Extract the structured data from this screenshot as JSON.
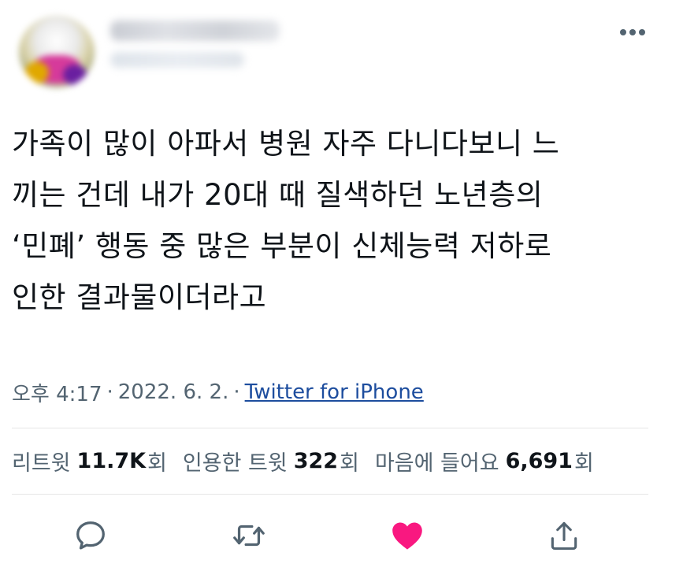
{
  "tweet": {
    "text": "가족이 많이 아파서 병원 자주 다니다보니 느\n끼는 건데 내가 20대 때 질색하던 노년층의\n‘민폐’ 행동 중 많은 부분이 신체능력 저하로\n인한 결과물이더라고",
    "time": "오후 4:17",
    "separator": "·",
    "date": "2022. 6. 2.",
    "source": "Twitter for iPhone"
  },
  "stats": {
    "retweets": {
      "label": "리트윗",
      "value": "11.7K",
      "unit": "회"
    },
    "quotes": {
      "label": "인용한 트윗",
      "value": "322",
      "unit": "회"
    },
    "likes": {
      "label": "마음에 들어요",
      "value": "6,691",
      "unit": "회"
    }
  },
  "icons": {
    "more": "more-horizontal-icon",
    "reply": "reply-bubble-icon",
    "retweet": "retweet-icon",
    "like": "heart-filled-icon",
    "share": "share-icon"
  },
  "colors": {
    "text": "#0f1419",
    "secondary": "#536471",
    "link": "#1d4d9e",
    "like": "#f91880",
    "icon": "#536471"
  }
}
